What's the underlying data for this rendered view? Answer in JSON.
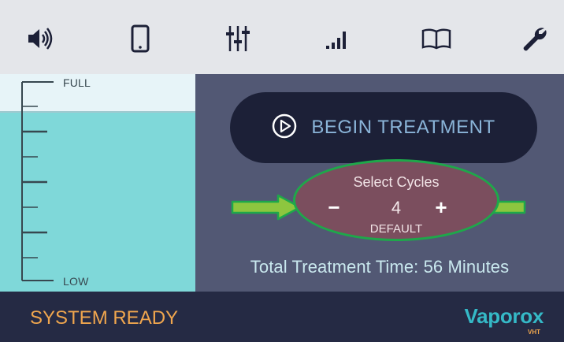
{
  "toolbar": {
    "icons": [
      "speaker-icon",
      "phone-icon",
      "equalizer-icon",
      "signal-icon",
      "book-icon",
      "wrench-icon"
    ]
  },
  "tank": {
    "full_label": "FULL",
    "low_label": "LOW",
    "level_percent": 83,
    "fill_color": "#7fd8d9"
  },
  "controls": {
    "begin_label": "BEGIN TREATMENT",
    "cycles": {
      "title": "Select Cycles",
      "minus": "−",
      "value": "4",
      "plus": "+",
      "default_label": "DEFAULT"
    },
    "total_time": "Total Treatment Time: 56 Minutes"
  },
  "status": {
    "text": "SYSTEM READY",
    "brand": "Vaporox",
    "brand_sub": "VHT"
  },
  "colors": {
    "accent_orange": "#f0a64e",
    "brand_teal": "#35b9c7",
    "highlight_green": "#1ea84a",
    "arrow_green": "#8dc63f"
  }
}
